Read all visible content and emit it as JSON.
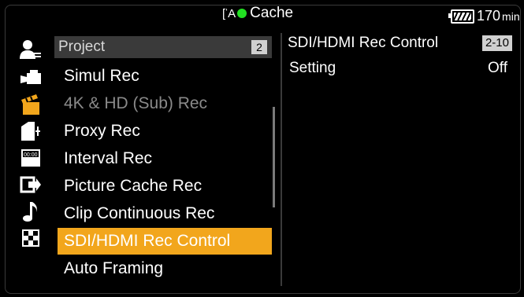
{
  "status": {
    "rec_mode_icon": "rec-mode-icon",
    "rec_indicator_color": "#22e022",
    "cache_label": "Cache",
    "battery_value": "170",
    "battery_unit": "min"
  },
  "sidebar_icons": [
    {
      "name": "user-settings-icon"
    },
    {
      "name": "camera-icon"
    },
    {
      "name": "clapperboard-icon"
    },
    {
      "name": "card-media-icon"
    },
    {
      "name": "timecode-icon"
    },
    {
      "name": "output-icon"
    },
    {
      "name": "audio-note-icon"
    },
    {
      "name": "grid-others-icon"
    }
  ],
  "menu": {
    "header_title": "Project",
    "header_page": "2",
    "items": [
      {
        "label": "Simul Rec",
        "state": "normal"
      },
      {
        "label": "4K & HD (Sub) Rec",
        "state": "disabled"
      },
      {
        "label": "Proxy Rec",
        "state": "normal"
      },
      {
        "label": "Interval Rec",
        "state": "normal"
      },
      {
        "label": "Picture Cache Rec",
        "state": "normal"
      },
      {
        "label": "Clip Continuous Rec",
        "state": "normal"
      },
      {
        "label": "SDI/HDMI Rec Control",
        "state": "selected"
      },
      {
        "label": "Auto Framing",
        "state": "normal"
      }
    ],
    "selected_color": "#f2a61c"
  },
  "detail": {
    "title": "SDI/HDMI Rec Control",
    "page": "2-10",
    "rows": [
      {
        "label": "Setting",
        "value": "Off"
      }
    ]
  }
}
